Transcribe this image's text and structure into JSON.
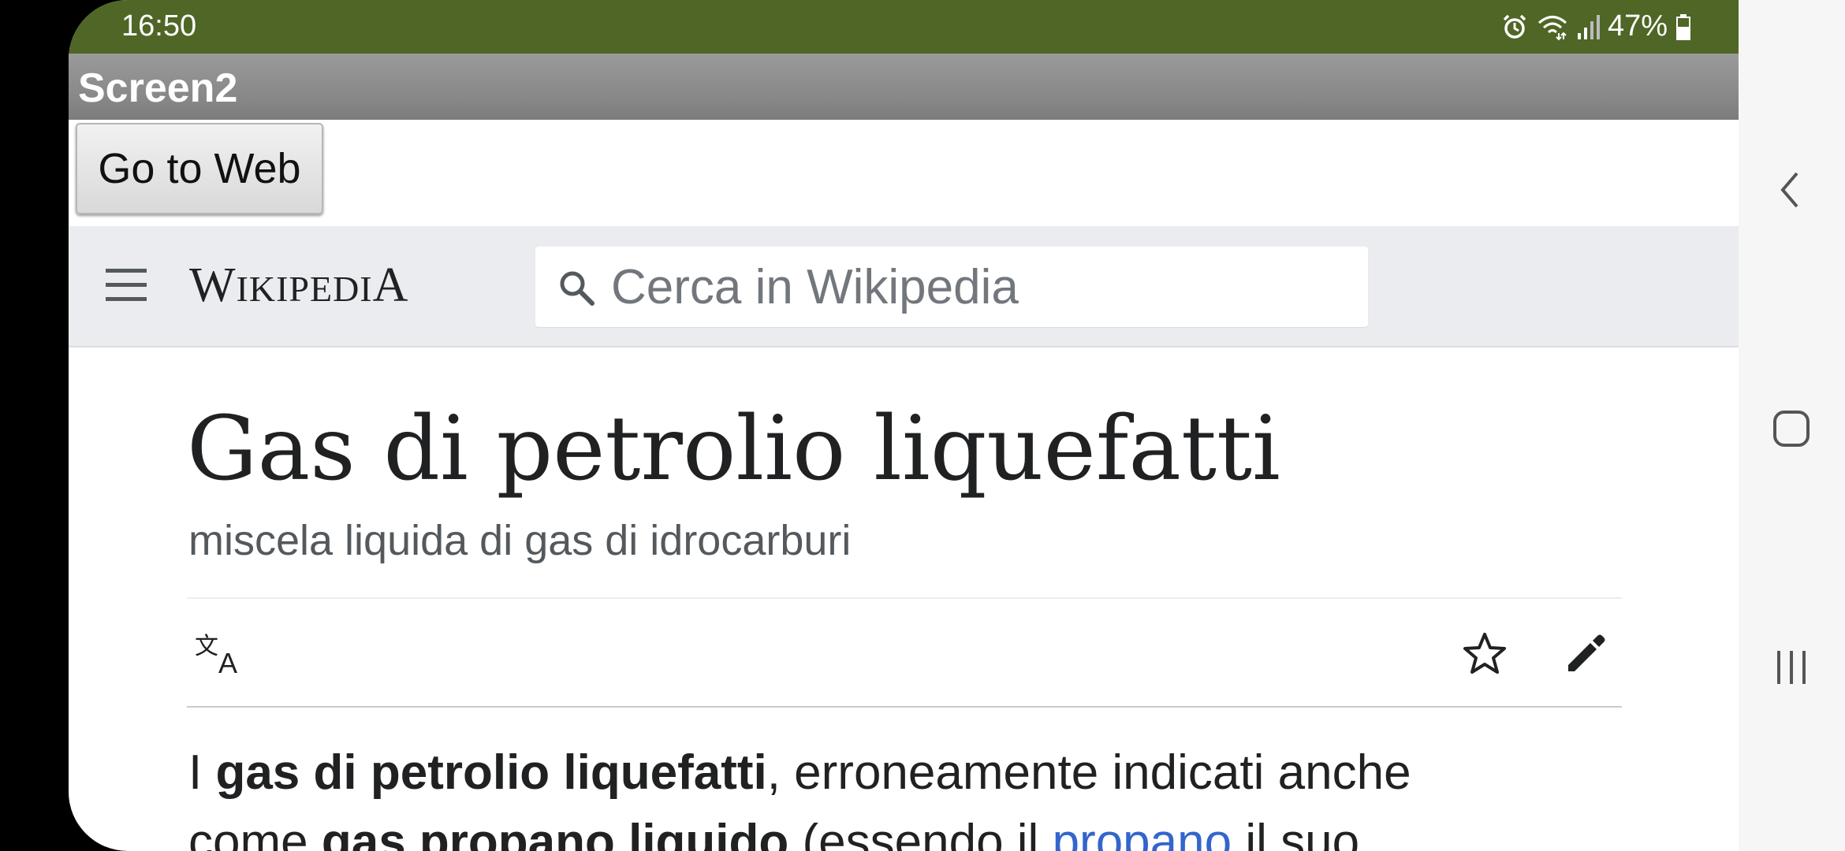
{
  "status_bar": {
    "time": "16:50",
    "battery": "47%",
    "icons": [
      "alarm-icon",
      "wifi-icon",
      "signal-icon",
      "battery-icon"
    ]
  },
  "app": {
    "title": "Screen2",
    "go_button_label": "Go to Web"
  },
  "wikipedia": {
    "logo_first": "W",
    "logo_mid": "IKIPEDI",
    "logo_last": "A",
    "search_placeholder": "Cerca in Wikipedia",
    "article": {
      "title": "Gas di petrolio liquefatti",
      "description": "miscela liquida di gas di idrocarburi",
      "line1_start": "I ",
      "line1_bold": "gas di petrolio liquefatti",
      "line1_end": ", erroneamente indicati anche",
      "line2_start": "come ",
      "line2_bold1": "gas propano",
      "line2_mid": " ",
      "line2_bold2": "liquido",
      "line2_text": " (essendo il ",
      "line2_link": "propano",
      "line2_end": " il suo"
    },
    "actions": [
      "language-icon",
      "star-icon",
      "edit-icon"
    ]
  },
  "colors": {
    "status_bar": "#4f6626",
    "title_bar": "#8a8a8a",
    "wiki_header": "#eaecf0",
    "link": "#3366cc"
  },
  "nav_bar": {
    "buttons": [
      "back-icon",
      "home-icon",
      "recents-icon"
    ]
  }
}
